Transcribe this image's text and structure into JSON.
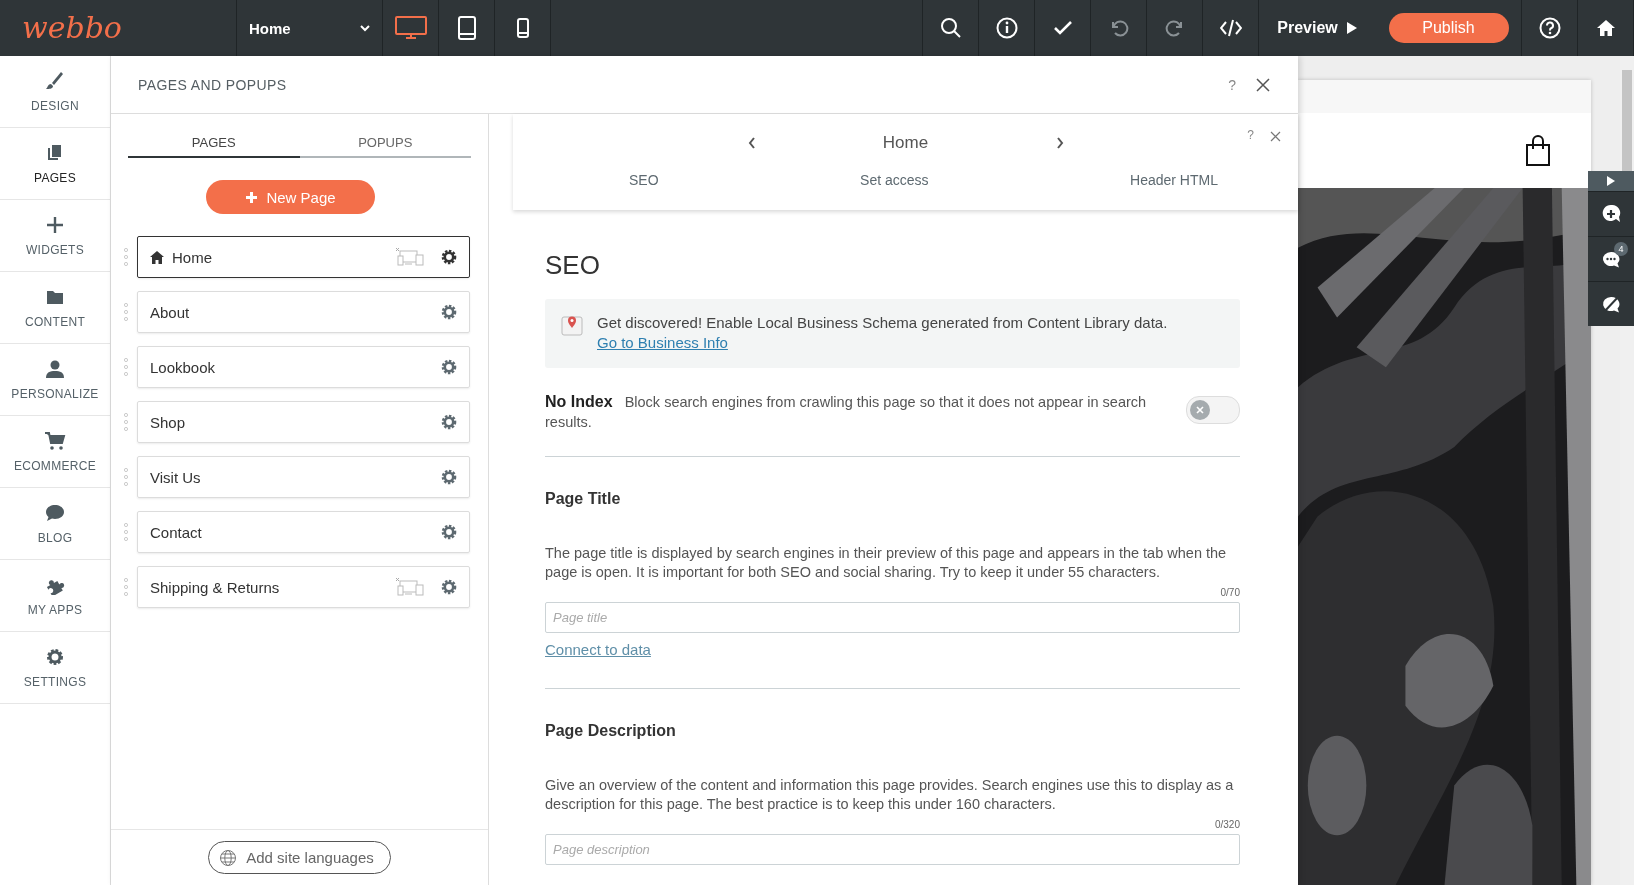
{
  "topbar": {
    "logo": "webbo",
    "page_select": "Home",
    "devices": [
      {
        "kind": "desktop",
        "selected": true
      },
      {
        "kind": "tablet",
        "selected": false
      },
      {
        "kind": "mobile",
        "selected": false
      }
    ],
    "preview": "Preview",
    "publish": "Publish"
  },
  "sidebar": {
    "items": [
      {
        "kind": "design",
        "label": "DESIGN",
        "selected": false
      },
      {
        "kind": "pages",
        "label": "PAGES",
        "selected": true
      },
      {
        "kind": "widgets",
        "label": "WIDGETS",
        "selected": false
      },
      {
        "kind": "content",
        "label": "CONTENT",
        "selected": false
      },
      {
        "kind": "personalize",
        "label": "PERSONALIZE",
        "selected": false
      },
      {
        "kind": "ecommerce",
        "label": "ECOMMERCE",
        "selected": false
      },
      {
        "kind": "blog",
        "label": "BLOG",
        "selected": false
      },
      {
        "kind": "apps",
        "label": "MY APPS",
        "selected": false
      },
      {
        "kind": "settings",
        "label": "SETTINGS",
        "selected": false
      }
    ]
  },
  "panel": {
    "title": "PAGES AND POPUPS",
    "help": "?",
    "tabs": [
      {
        "label": "PAGES",
        "selected": true
      },
      {
        "label": "POPUPS",
        "selected": false
      }
    ],
    "new_page": "New Page",
    "pages": [
      {
        "name": "Home",
        "selected": true,
        "homepage": true,
        "device_hidden": true
      },
      {
        "name": "About",
        "selected": false,
        "homepage": false,
        "device_hidden": false
      },
      {
        "name": "Lookbook",
        "selected": false,
        "homepage": false,
        "device_hidden": false
      },
      {
        "name": "Shop",
        "selected": false,
        "homepage": false,
        "device_hidden": false
      },
      {
        "name": "Visit Us",
        "selected": false,
        "homepage": false,
        "device_hidden": false
      },
      {
        "name": "Contact",
        "selected": false,
        "homepage": false,
        "device_hidden": false
      },
      {
        "name": "Shipping & Returns",
        "selected": false,
        "homepage": false,
        "device_hidden": true
      }
    ],
    "add_languages": "Add site languages"
  },
  "editor": {
    "page": "Home",
    "help": "?",
    "tabs": [
      "SEO",
      "Set access",
      "Header HTML"
    ],
    "heading": "SEO",
    "notice": {
      "text": "Get discovered! Enable Local Business Schema generated from Content Library data.",
      "link": "Go to Business Info"
    },
    "no_index": {
      "label": "No Index",
      "text": "Block search engines from crawling this page so that it does not appear in search results.",
      "on": false
    },
    "sections": [
      {
        "title": "Page Title",
        "description": "The page title is displayed by search engines in their preview of this page and appears in the tab when the page is open. It is important for both SEO and social sharing. Try to keep it under 55 characters.",
        "counter": "0/70",
        "placeholder": "Page title",
        "link": "Connect to data"
      },
      {
        "title": "Page Description",
        "description": "Give an overview of the content and information this page provides. Search engines use this to display as a description for this page. The best practice is to keep this under 160 characters.",
        "counter": "0/320",
        "placeholder": "Page description"
      }
    ]
  },
  "preview": {
    "comments_badge": "4"
  }
}
